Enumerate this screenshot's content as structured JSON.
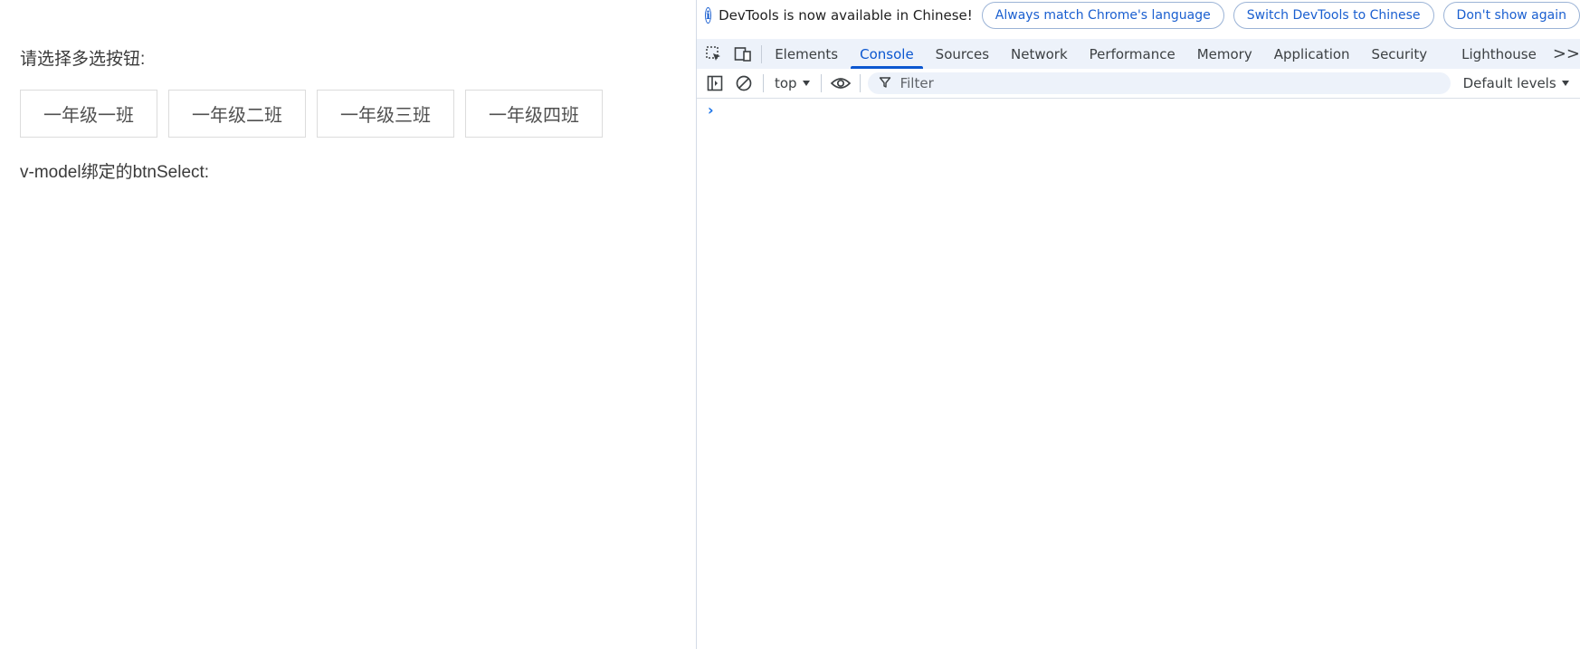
{
  "page": {
    "prompt_label": "请选择多选按钮:",
    "buttons": [
      "一年级一班",
      "一年级二班",
      "一年级三班",
      "一年级四班"
    ],
    "binding_label": "v-model绑定的btnSelect:"
  },
  "devtools": {
    "infobar": {
      "icon": "info-icon",
      "message": "DevTools is now available in Chinese!",
      "always_match": "Always match Chrome's language",
      "switch_lang": "Switch DevTools to Chinese",
      "dont_show": "Don't show again"
    },
    "tabs": {
      "inspect_icon": "inspect-element-icon",
      "device_icon": "device-toolbar-icon",
      "items": [
        "Elements",
        "Console",
        "Sources",
        "Network",
        "Performance",
        "Memory",
        "Application",
        "Security",
        "Lighthouse"
      ],
      "active": "Console",
      "more": ">>"
    },
    "console_toolbar": {
      "context": "top",
      "filter_placeholder": "Filter",
      "levels": "Default levels"
    },
    "prompt_glyph": "›",
    "accent_color": "#0b57d0"
  }
}
